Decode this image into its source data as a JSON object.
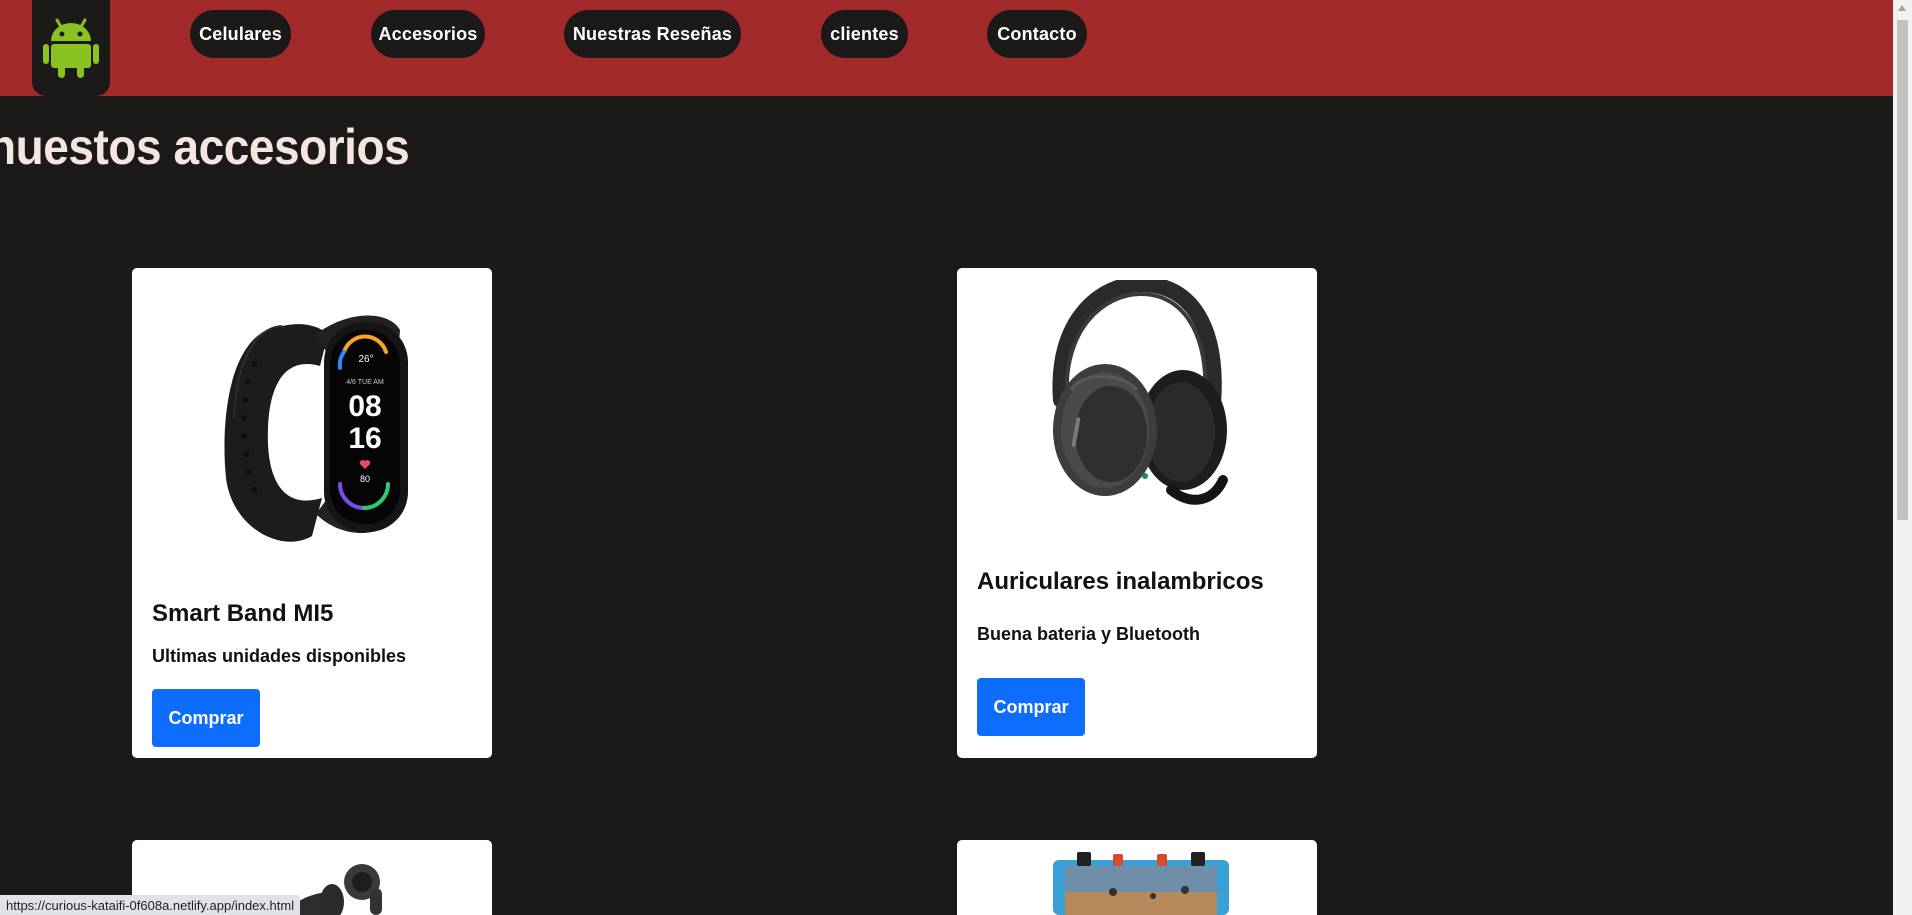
{
  "header": {
    "logo_icon": "android-icon",
    "brand_color": "#a32a2b",
    "nav": [
      {
        "label": "Celulares"
      },
      {
        "label": "Accesorios"
      },
      {
        "label": "Nuestras Reseñas"
      },
      {
        "label": "clientes"
      },
      {
        "label": "Contacto"
      }
    ]
  },
  "main": {
    "title": "nuestos accesorios",
    "products": [
      {
        "name": "Smart Band MI5",
        "description": "Ultimas unidades disponibles",
        "button_label": "Comprar",
        "image_icon": "smart-band-image",
        "watch_face": {
          "temp": "26°",
          "date": "4/6 TUE AM",
          "hour": "08",
          "minute": "16",
          "heart_rate": "80"
        }
      },
      {
        "name": "Auriculares inalambricos",
        "description": "Buena bateria y Bluetooth",
        "button_label": "Comprar",
        "image_icon": "headphones-image"
      },
      {
        "image_icon": "earbuds-image"
      },
      {
        "image_icon": "gamepad-phone-image"
      }
    ],
    "button_color": "#0d6efd"
  },
  "status_bar": {
    "url": "https://curious-kataifi-0f608a.netlify.app/index.html"
  }
}
